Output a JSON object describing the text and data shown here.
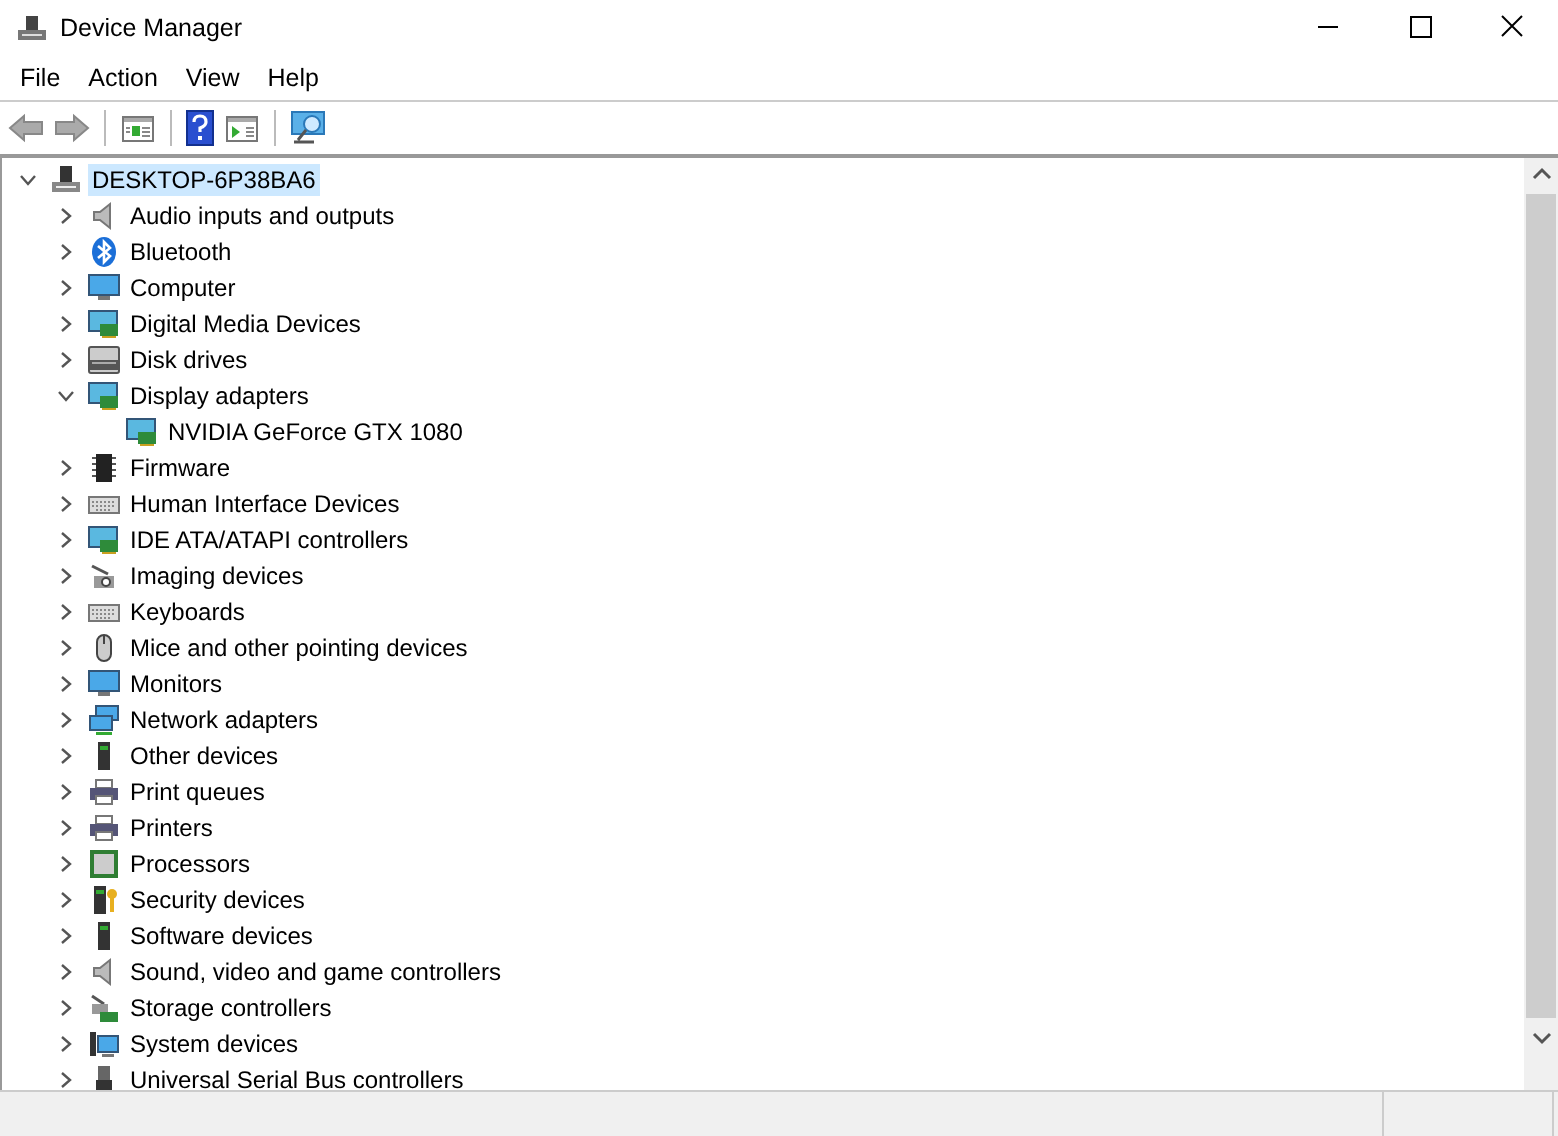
{
  "window": {
    "title": "Device Manager"
  },
  "menu": [
    "File",
    "Action",
    "View",
    "Help"
  ],
  "tree": {
    "label": "DESKTOP-6P38BA6",
    "expanded": true,
    "selected": true,
    "children": [
      {
        "label": "Audio inputs and outputs",
        "expanded": false,
        "selected": false
      },
      {
        "label": "Bluetooth",
        "expanded": false,
        "selected": false
      },
      {
        "label": "Computer",
        "expanded": false,
        "selected": false
      },
      {
        "label": "Digital Media Devices",
        "expanded": false,
        "selected": false
      },
      {
        "label": "Disk drives",
        "expanded": false,
        "selected": false
      },
      {
        "label": "Display adapters",
        "expanded": true,
        "selected": false,
        "children": [
          {
            "label": "NVIDIA GeForce GTX 1080",
            "selected": false
          }
        ]
      },
      {
        "label": "Firmware",
        "expanded": false,
        "selected": false
      },
      {
        "label": "Human Interface Devices",
        "expanded": false,
        "selected": false
      },
      {
        "label": "IDE ATA/ATAPI controllers",
        "expanded": false,
        "selected": false
      },
      {
        "label": "Imaging devices",
        "expanded": false,
        "selected": false
      },
      {
        "label": "Keyboards",
        "expanded": false,
        "selected": false
      },
      {
        "label": "Mice and other pointing devices",
        "expanded": false,
        "selected": false
      },
      {
        "label": "Monitors",
        "expanded": false,
        "selected": false
      },
      {
        "label": "Network adapters",
        "expanded": false,
        "selected": false
      },
      {
        "label": "Other devices",
        "expanded": false,
        "selected": false
      },
      {
        "label": "Print queues",
        "expanded": false,
        "selected": false
      },
      {
        "label": "Printers",
        "expanded": false,
        "selected": false
      },
      {
        "label": "Processors",
        "expanded": false,
        "selected": false
      },
      {
        "label": "Security devices",
        "expanded": false,
        "selected": false
      },
      {
        "label": "Software devices",
        "expanded": false,
        "selected": false
      },
      {
        "label": "Sound, video and game controllers",
        "expanded": false,
        "selected": false
      },
      {
        "label": "Storage controllers",
        "expanded": false,
        "selected": false
      },
      {
        "label": "System devices",
        "expanded": false,
        "selected": false
      },
      {
        "label": "Universal Serial Bus controllers",
        "expanded": false,
        "selected": false
      }
    ]
  }
}
